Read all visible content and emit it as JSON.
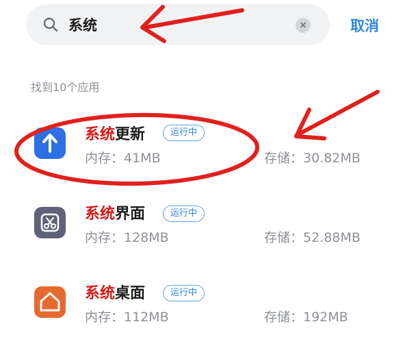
{
  "search": {
    "value": "系统",
    "clear_glyph": "×",
    "cancel_label": "取消"
  },
  "results_label": "找到10个应用",
  "apps": [
    {
      "name_highlight": "系统",
      "name_rest": "更新",
      "status": "运行中",
      "memory": "内存：41MB",
      "storage": "存储：30.82MB",
      "icon": "up-arrow-icon",
      "icon_color": "#2e6fe6"
    },
    {
      "name_highlight": "系统",
      "name_rest": "界面",
      "status": "运行中",
      "memory": "内存：128MB",
      "storage": "存储：52.88MB",
      "icon": "scissors-icon",
      "icon_color": "#5e6378"
    },
    {
      "name_highlight": "系统",
      "name_rest": "桌面",
      "status": "运行中",
      "memory": "内存：112MB",
      "storage": "存储：192MB",
      "icon": "home-icon",
      "icon_color": "#e66a2e"
    }
  ],
  "colors": {
    "highlight": "#d71a1a",
    "accent": "#2f86e0",
    "annotation": "#e0211d"
  }
}
